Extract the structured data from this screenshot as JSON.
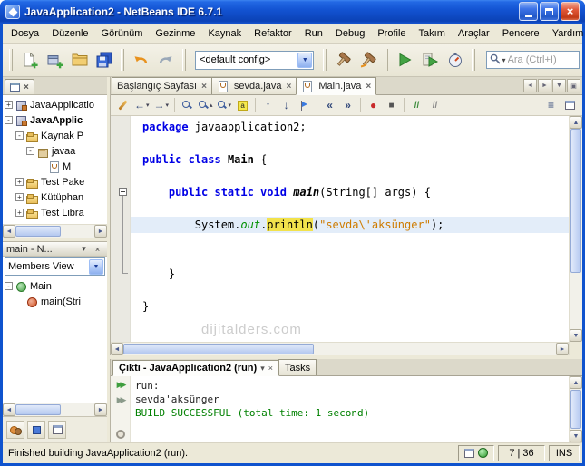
{
  "window": {
    "title": "JavaApplication2 - NetBeans IDE 6.7.1"
  },
  "menubar": [
    "Dosya",
    "Düzenle",
    "Görünüm",
    "Gezinme",
    "Kaynak",
    "Refaktor",
    "Run",
    "Debug",
    "Profile",
    "Takım",
    "Araçlar",
    "Pencere",
    "Yardım"
  ],
  "toolbar": {
    "config": "<default config>",
    "search_placeholder": "Ara (Ctrl+I)"
  },
  "projects": {
    "tree": [
      {
        "label": "JavaApplicatio",
        "indent": 0,
        "icon": "project",
        "exp": "closed"
      },
      {
        "label": "JavaApplic",
        "indent": 0,
        "icon": "project",
        "exp": "open",
        "bold": true
      },
      {
        "label": "Kaynak P",
        "indent": 1,
        "icon": "folder",
        "exp": "open"
      },
      {
        "label": "javaa",
        "indent": 2,
        "icon": "package",
        "exp": "open"
      },
      {
        "label": "M",
        "indent": 3,
        "icon": "javafile"
      },
      {
        "label": "Test Pake",
        "indent": 1,
        "icon": "folder",
        "exp": "closed"
      },
      {
        "label": "Kütüphan",
        "indent": 1,
        "icon": "folder",
        "exp": "closed"
      },
      {
        "label": "Test Libra",
        "indent": 1,
        "icon": "folder",
        "exp": "closed"
      }
    ]
  },
  "navigator": {
    "title": "main - N...",
    "view_filter": "Members View",
    "tree": [
      {
        "label": "Main",
        "indent": 0,
        "icon": "class",
        "exp": "open"
      },
      {
        "label": "main(Stri",
        "indent": 1,
        "icon": "method"
      }
    ]
  },
  "editor": {
    "tabs": [
      {
        "label": "Başlangıç Sayfası",
        "icon": false,
        "active": false
      },
      {
        "label": "sevda.java",
        "icon": true,
        "active": false
      },
      {
        "label": "Main.java",
        "icon": true,
        "active": true
      }
    ],
    "code": {
      "current_line": 7,
      "fold": {
        "start": 5,
        "end": 10
      },
      "lines": [
        {
          "s": [
            {
              "t": "package",
              "c": "kw"
            },
            {
              "t": " javaapplication2;",
              "c": "pl"
            }
          ]
        },
        {
          "s": []
        },
        {
          "s": [
            {
              "t": "public class",
              "c": "kw"
            },
            {
              "t": " ",
              "c": "pl"
            },
            {
              "t": "Main",
              "c": "cn"
            },
            {
              "t": " {",
              "c": "pl"
            }
          ]
        },
        {
          "s": []
        },
        {
          "s": [
            {
              "t": "    ",
              "c": "pl"
            },
            {
              "t": "public static void",
              "c": "kw"
            },
            {
              "t": " ",
              "c": "pl"
            },
            {
              "t": "main",
              "c": "mt"
            },
            {
              "t": "(String[] args) {",
              "c": "pl"
            }
          ]
        },
        {
          "s": []
        },
        {
          "s": [
            {
              "t": "        System.",
              "c": "pl"
            },
            {
              "t": "out",
              "c": "sf"
            },
            {
              "t": ".",
              "c": "pl"
            },
            {
              "t": "println",
              "c": "hl"
            },
            {
              "t": "(",
              "c": "pl"
            },
            {
              "t": "\"sevda\\'aksünger\"",
              "c": "st"
            },
            {
              "t": ");",
              "c": "pl"
            }
          ]
        },
        {
          "s": []
        },
        {
          "s": []
        },
        {
          "s": [
            {
              "t": "    }",
              "c": "pl"
            }
          ]
        },
        {
          "s": []
        },
        {
          "s": [
            {
              "t": "}",
              "c": "pl"
            }
          ]
        }
      ]
    }
  },
  "output": {
    "tabs": [
      {
        "label": "Çıktı - JavaApplication2 (run)",
        "active": true
      },
      {
        "label": "Tasks",
        "active": false
      }
    ],
    "lines": [
      {
        "t": "run:",
        "c": "pl"
      },
      {
        "t": "sevda'aksünger",
        "c": "pl"
      },
      {
        "t": "BUILD SUCCESSFUL (total time: 1 second)",
        "c": "ok"
      }
    ]
  },
  "statusbar": {
    "message": "Finished building JavaApplication2 (run).",
    "position": "7 | 36",
    "mode": "INS"
  },
  "watermark": "dijitalders.com",
  "colors": {
    "keyword": "#0000E6",
    "string": "#CE7B00",
    "static_field": "#009100",
    "occurrence_highlight": "#F2E24C",
    "build_success": "#008000",
    "current_line_bg": "#E3EDF9",
    "titlebar_blue": "#1353D2",
    "run_green": "#44A344"
  }
}
